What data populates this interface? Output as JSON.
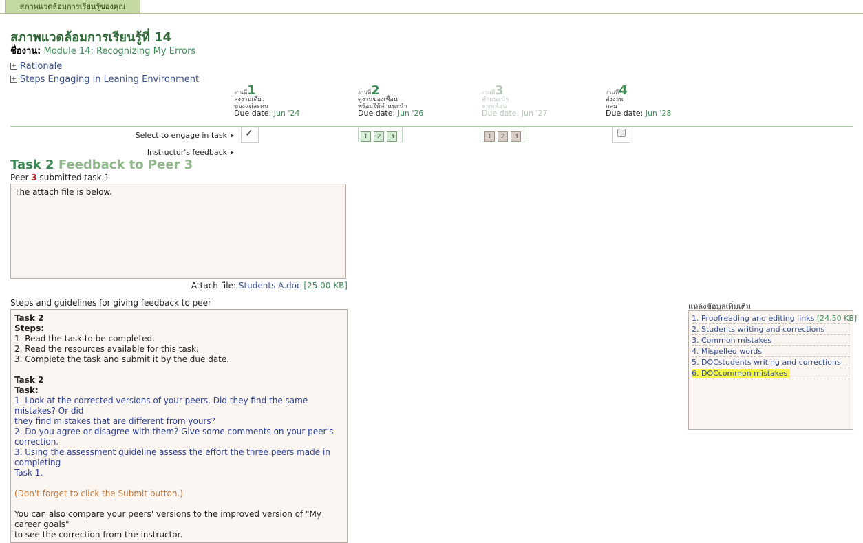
{
  "tab": {
    "label": "สภาพแวดล้อมการเรียนรู้ของคุณ"
  },
  "header": {
    "title": "สภาพแวดล้อมการเรียนรู้ที่ 14",
    "work_label": "ชื่องาน:",
    "work_value": "Module 14: Recognizing My Errors"
  },
  "expanders": [
    {
      "icon": "plus-box-icon",
      "label": "Rationale"
    },
    {
      "icon": "plus-box-icon",
      "label": "Steps Engaging in Leaning Environment"
    }
  ],
  "stages": [
    {
      "no_label": "งานที่",
      "num": "1",
      "line1": "ส่งงานเดี่ยว",
      "line2": "ของแต่ละคน",
      "due_label": "Due date:",
      "due": "Jun '24"
    },
    {
      "no_label": "งานที่",
      "num": "2",
      "line1": "ดูงานของเพื่อน",
      "line2": "พร้อมให้คำแนะนำ",
      "due_label": "Due date:",
      "due": "Jun '26"
    },
    {
      "no_label": "งานที่",
      "num": "3",
      "line1": "คำแนะนำ",
      "line2": "จากเพื่อน",
      "due_label": "Due date:",
      "due": "Jun '27"
    },
    {
      "no_label": "งานที่",
      "num": "4",
      "line1": "ส่งงาน",
      "line2": "กลุ่ม",
      "due_label": "Due date:",
      "due": "Jun '28"
    }
  ],
  "rows": {
    "select_label": "Select to engage in task",
    "feedback_label": "Instructor's feedback"
  },
  "stage2_peers": [
    "1",
    "2",
    "3"
  ],
  "stage3_peers": [
    "1",
    "2",
    "3"
  ],
  "task": {
    "title_prefix": "Task 2",
    "title_suffix": "Feedback to Peer 3",
    "peer_prefix": "Peer",
    "peer_num": "3",
    "peer_suffix": "submitted task 1",
    "submission_text": "The attach file is below.",
    "attach_label": "Attach file:",
    "attach_file": "Students A.doc",
    "attach_size": "[25.00 KB]"
  },
  "steps": {
    "heading": "Steps and guidelines for giving feedback to peer",
    "t1": "Task 2",
    "s_label": "Steps:",
    "s1": "1. Read the task to be completed.",
    "s2": "2. Read the resources available for this task.",
    "s3": "3. Complete the task and submit it by the due date.",
    "t2": "Task 2",
    "task_label": "Task:",
    "k1a": "1. Look at the corrected versions of your peers. Did they find the same mistakes? Or did",
    "k1b": "they find mistakes that are different from yours?",
    "k2": "2. Do you agree or disagree with them? Give some comments on your peer’s correction.",
    "k3a": "3. Using the assessment guideline assess the effort the three peers made in completing",
    "k3b": "Task 1.",
    "reminder": "(Don't forget to click the Submit button.)",
    "compare_a": "You can also compare your peers' versions to the improved version of \"My career goals\"",
    "compare_b": "to see the correction from the instructor."
  },
  "resources": {
    "heading": "แหล่งข้อมูลเพิ่มเติม",
    "items": [
      {
        "label": "1. Proofreading and editing links",
        "size": "[24.50 KB]"
      },
      {
        "label": "2. Students writing and corrections",
        "size": ""
      },
      {
        "label": "3. Common mistakes",
        "size": ""
      },
      {
        "label": "4. Mispelled words",
        "size": ""
      },
      {
        "label": "5. DOCstudents writing and corrections",
        "size": ""
      },
      {
        "label": "6. DOCcommon mistakes",
        "size": ""
      }
    ]
  }
}
